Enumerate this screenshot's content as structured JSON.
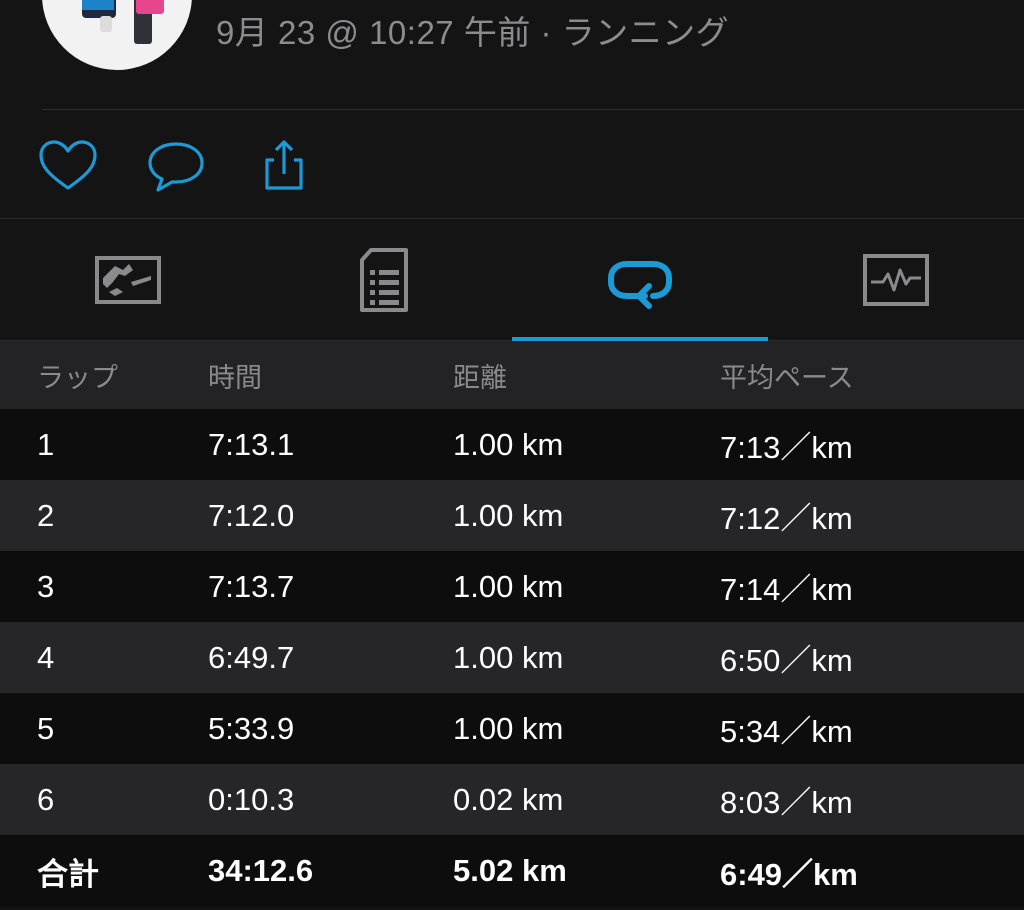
{
  "header": {
    "subtitle": "9月 23 @ 10:27 午前 · ランニング"
  },
  "actions": [
    {
      "name": "like",
      "icon": "heart-icon"
    },
    {
      "name": "comment",
      "icon": "speech-bubble-icon"
    },
    {
      "name": "share",
      "icon": "share-icon"
    }
  ],
  "tabs": [
    {
      "name": "map",
      "icon": "map-icon",
      "active": false
    },
    {
      "name": "details",
      "icon": "document-list-icon",
      "active": false
    },
    {
      "name": "laps",
      "icon": "loop-arrow-icon",
      "active": true
    },
    {
      "name": "charts",
      "icon": "heart-rate-chart-icon",
      "active": false
    }
  ],
  "colors": {
    "accent": "#1c9ad6",
    "inactive_icon": "#8a8a8c",
    "background": "#141415"
  },
  "table": {
    "headers": [
      "ラップ",
      "時間",
      "距離",
      "平均ペース"
    ],
    "rows": [
      [
        "1",
        "7:13.1",
        "1.00 km",
        "7:13／km"
      ],
      [
        "2",
        "7:12.0",
        "1.00 km",
        "7:12／km"
      ],
      [
        "3",
        "7:13.7",
        "1.00 km",
        "7:14／km"
      ],
      [
        "4",
        "6:49.7",
        "1.00 km",
        "6:50／km"
      ],
      [
        "5",
        "5:33.9",
        "1.00 km",
        "5:34／km"
      ],
      [
        "6",
        "0:10.3",
        "0.02 km",
        "8:03／km"
      ]
    ],
    "total": [
      "合計",
      "34:12.6",
      "5.02 km",
      "6:49／km"
    ]
  }
}
